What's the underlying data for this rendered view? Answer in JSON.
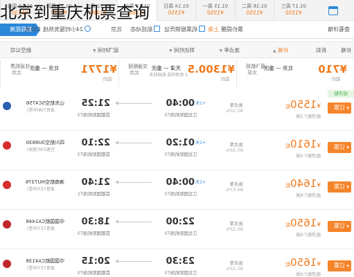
{
  "title": "北京到重庆机票查询",
  "date_strip": [
    {
      "date": "01.10 周日",
      "price": "¥1430"
    },
    {
      "date": "01.11 周四",
      "price": "¥1480"
    },
    {
      "date": "01.12 周五",
      "price": "¥1480"
    },
    {
      "date": "01.13 周六",
      "price": "¥1480"
    },
    {
      "date": "01.14 周日",
      "price": "¥1550"
    },
    {
      "date": "01.15 周一",
      "price": "¥1550"
    },
    {
      "date": "01.16 周二",
      "price": "¥1550"
    },
    {
      "date": "01.17 周三",
      "price": "¥1550"
    }
  ],
  "toolbar": {
    "distance_label": "航程距离",
    "item1": "24小时服务热线 155元",
    "item2": "北京",
    "item3": "航班动态",
    "item4": "机票报销凭证",
    "item5": "票价提醒",
    "item5_accent": "上海",
    "item6": "查看详情"
  },
  "columns": {
    "airline": "航空公司",
    "depart": "起飞时间",
    "arrive": "到达时间",
    "punctuality": "准点率",
    "price": "价格",
    "discount": "折扣",
    "sort": "价格"
  },
  "recs": [
    {
      "tag": "直飞航班",
      "tag2": "太原",
      "route": "北京 — 重庆",
      "route2": "",
      "price": "¥710",
      "plabel": "起价"
    },
    {
      "tag": "交通枢纽",
      "tag2": "北京",
      "route": "天津 — 重庆",
      "route2": "2 机场可选 航线较多",
      "price": "¥1300.5",
      "plabel": "起价"
    },
    {
      "tag": "往返机票",
      "tag2": "北京",
      "route": "北京 — 重庆",
      "route2": "",
      "price": "¥1771",
      "plabel": "起价"
    }
  ],
  "low_tag": "经济舱",
  "flights": [
    {
      "airline": "山东航空SC4756",
      "sub": "波音738(中型)",
      "dep": "21:25",
      "dep_apt": "首都国际机场T3",
      "arr": "00:40",
      "arr_apt": "江北国际机场T3",
      "nextday": "+1天",
      "rate": "准点率",
      "rate2": "80.32%",
      "price": "1550",
      "pnote": "经济舱7.2折",
      "book": "订票",
      "logo": "#2b5fb0"
    },
    {
      "airline": "四川航空3U8830",
      "sub": "空客330(宽体)",
      "dep": "22:10",
      "dep_apt": "首都国际机场T3",
      "arr": "01:20",
      "arr_apt": "江北国际机场T3",
      "nextday": "+1天",
      "rate": "准点率",
      "rate2": "80.32%",
      "price": "1610",
      "pnote": "经济舱7.5折",
      "book": "订票",
      "logo": "#d62e2e"
    },
    {
      "airline": "海南航空HU7376",
      "sub": "波音737(中型)",
      "dep": "21:40",
      "dep_apt": "首都国际机场T1",
      "arr": "00:40",
      "arr_apt": "江北国际机场T3",
      "nextday": "+1天",
      "rate": "准点率",
      "rate2": "84.57%",
      "price": "1640",
      "pnote": "经济舱7.6折",
      "book": "订票",
      "logo": "#d62e2e"
    },
    {
      "airline": "中国国航CA1448",
      "sub": "波音737(中型)",
      "dep": "18:30",
      "dep_apt": "首都国际机场T3",
      "arr": "22:00",
      "arr_apt": "江北国际机场T3",
      "nextday": "",
      "rate": "准点率",
      "rate2": "80.32%",
      "price": "1650",
      "pnote": "经济舱7.6折",
      "book": "订票",
      "logo": "#c0262d"
    },
    {
      "airline": "中国国航CA4138",
      "sub": "波音737(中型)",
      "dep": "20:15",
      "dep_apt": "首都国际机场T3",
      "arr": "23:30",
      "arr_apt": "江北国际机场T3",
      "nextday": "",
      "rate": "准点率",
      "rate2": "80.32%",
      "price": "1650",
      "pnote": "经济舱7.6折",
      "book": "订票",
      "logo": "#c0262d"
    }
  ]
}
